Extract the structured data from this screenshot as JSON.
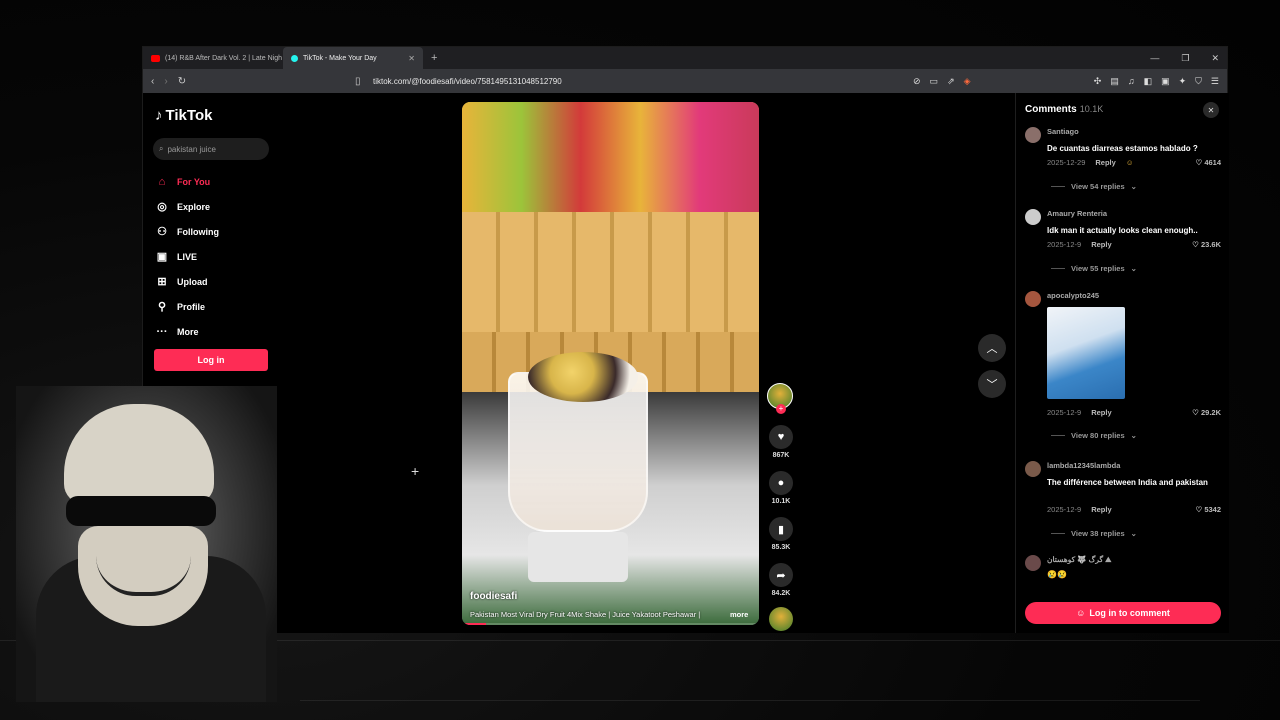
{
  "browser": {
    "tabs": [
      {
        "label": "(14) R&B After Dark Vol. 2 | Late Nigh",
        "fav_color": "#ff0000"
      },
      {
        "label": "TikTok - Make Your Day",
        "fav_color": "#25f4ee"
      }
    ],
    "new_tab": "+",
    "url": "tiktok.com/@foodiesafi/video/7581495131048512790"
  },
  "sidebar": {
    "logo": "TikTok",
    "search_value": "pakistan juice",
    "nav": [
      {
        "label": "For You",
        "icon": "home-icon"
      },
      {
        "label": "Explore",
        "icon": "compass-icon"
      },
      {
        "label": "Following",
        "icon": "person-plus-icon"
      },
      {
        "label": "LIVE",
        "icon": "live-tv-icon"
      },
      {
        "label": "Upload",
        "icon": "upload-plus-icon"
      },
      {
        "label": "Profile",
        "icon": "person-icon"
      },
      {
        "label": "More",
        "icon": "more-dots-icon"
      }
    ],
    "login": "Log in"
  },
  "video": {
    "username": "foodiesafi",
    "description": "Pakistan Most Viral Dry Fruit 4Mix Shake | Juice Yakatoot Peshawar |",
    "more": "more",
    "progress": 0.08
  },
  "actions": {
    "likes": "867K",
    "comments": "10.1K",
    "saves": "85.3K",
    "shares": "84.2K"
  },
  "comments": {
    "title": "Comments",
    "count": "10.1K",
    "items": [
      {
        "user": "Santiago",
        "text": "De cuantas diarreas estamos hablado ?",
        "date": "2025-12-29",
        "reply": "Reply",
        "likes": "4614",
        "replies": "View 54 replies",
        "avatar_color": "#8a6f6a"
      },
      {
        "user": "Amaury Renteria",
        "text": "Idk man it actually looks clean enough..",
        "date": "2025-12-9",
        "reply": "Reply",
        "likes": "23.6K",
        "replies": "View 55 replies",
        "avatar_color": "#ccc"
      },
      {
        "user": "apocalypto245",
        "text": "",
        "date": "2025-12-9",
        "reply": "Reply",
        "likes": "29.2K",
        "replies": "View 80 replies",
        "avatar_color": "#a5563e"
      },
      {
        "user": "lambda12345lambda",
        "text": "The différence between India and pakistan",
        "date": "2025-12-9",
        "reply": "Reply",
        "likes": "5342",
        "replies": "View 38 replies",
        "avatar_color": "#7a5a4a"
      },
      {
        "user": "گرگ 🐺 کوهستان ⛰",
        "text": "😢😢",
        "avatar_color": "#6a4a4a"
      }
    ],
    "login_button": "Log in to comment"
  },
  "colors": {
    "accent": "#fe2c55"
  }
}
